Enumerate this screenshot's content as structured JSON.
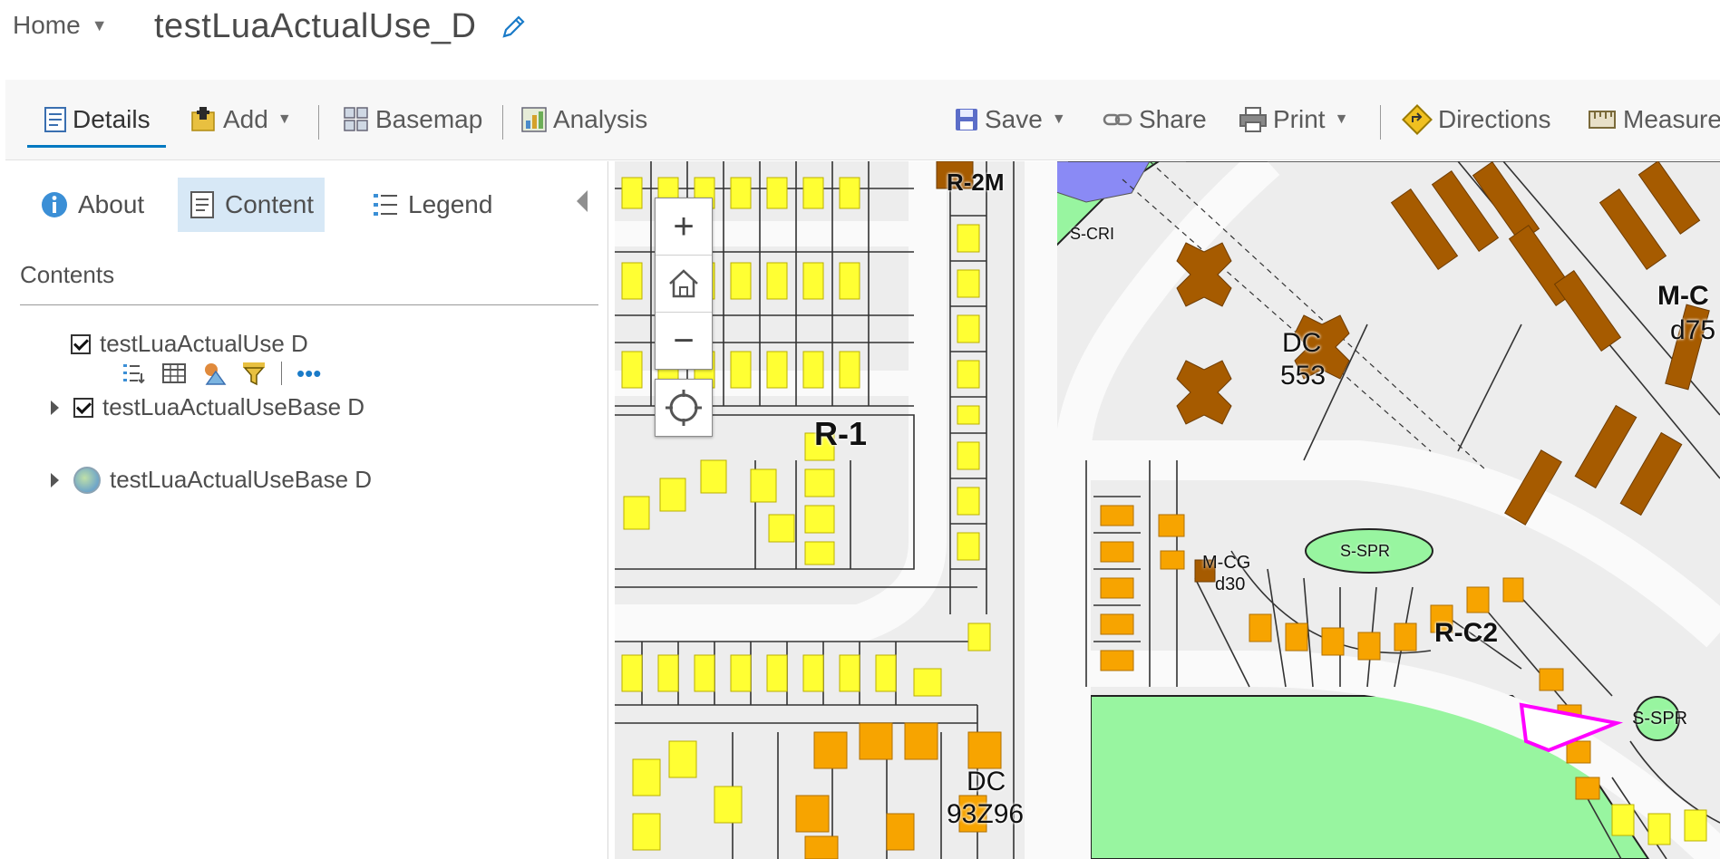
{
  "header": {
    "home_label": "Home",
    "map_title": "testLuaActualUse_D"
  },
  "toolbar": {
    "details": "Details",
    "add": "Add",
    "basemap": "Basemap",
    "analysis": "Analysis",
    "save": "Save",
    "share": "Share",
    "print": "Print",
    "directions": "Directions",
    "measure": "Measure"
  },
  "panel": {
    "tabs": {
      "about": "About",
      "content": "Content",
      "legend": "Legend"
    },
    "contents_heading": "Contents",
    "layers": [
      {
        "name": "testLuaActualUse D",
        "checked": true
      },
      {
        "name": "testLuaActualUseBase D",
        "checked": true
      },
      {
        "name": "testLuaActualUseBase D",
        "checked": false
      }
    ]
  },
  "map": {
    "zoom_in": "+",
    "zoom_out": "−",
    "labels": {
      "r2m": "R-2M",
      "scri": "S-CRI",
      "dc553_a": "DC",
      "dc553_b": "553",
      "mc_a": "M-C",
      "mc_b": "d75",
      "r1": "R-1",
      "sspr1": "S-SPR",
      "mcg_a": "M-CG",
      "mcg_b": "d30",
      "rc2": "R-C2",
      "sspr2": "S-SPR",
      "dc93_a": "DC",
      "dc93_b": "93Z96"
    }
  },
  "colors": {
    "accent": "#0079c1",
    "active_tab_bg": "#d7e8f6",
    "residential_yellow": "#ffff33",
    "commercial_orange": "#f7a400",
    "brown": "#a65b00",
    "open_space_green": "#98f5a0",
    "highlight_magenta": "#ff00ff",
    "institutional_purple": "#8a8af5"
  }
}
